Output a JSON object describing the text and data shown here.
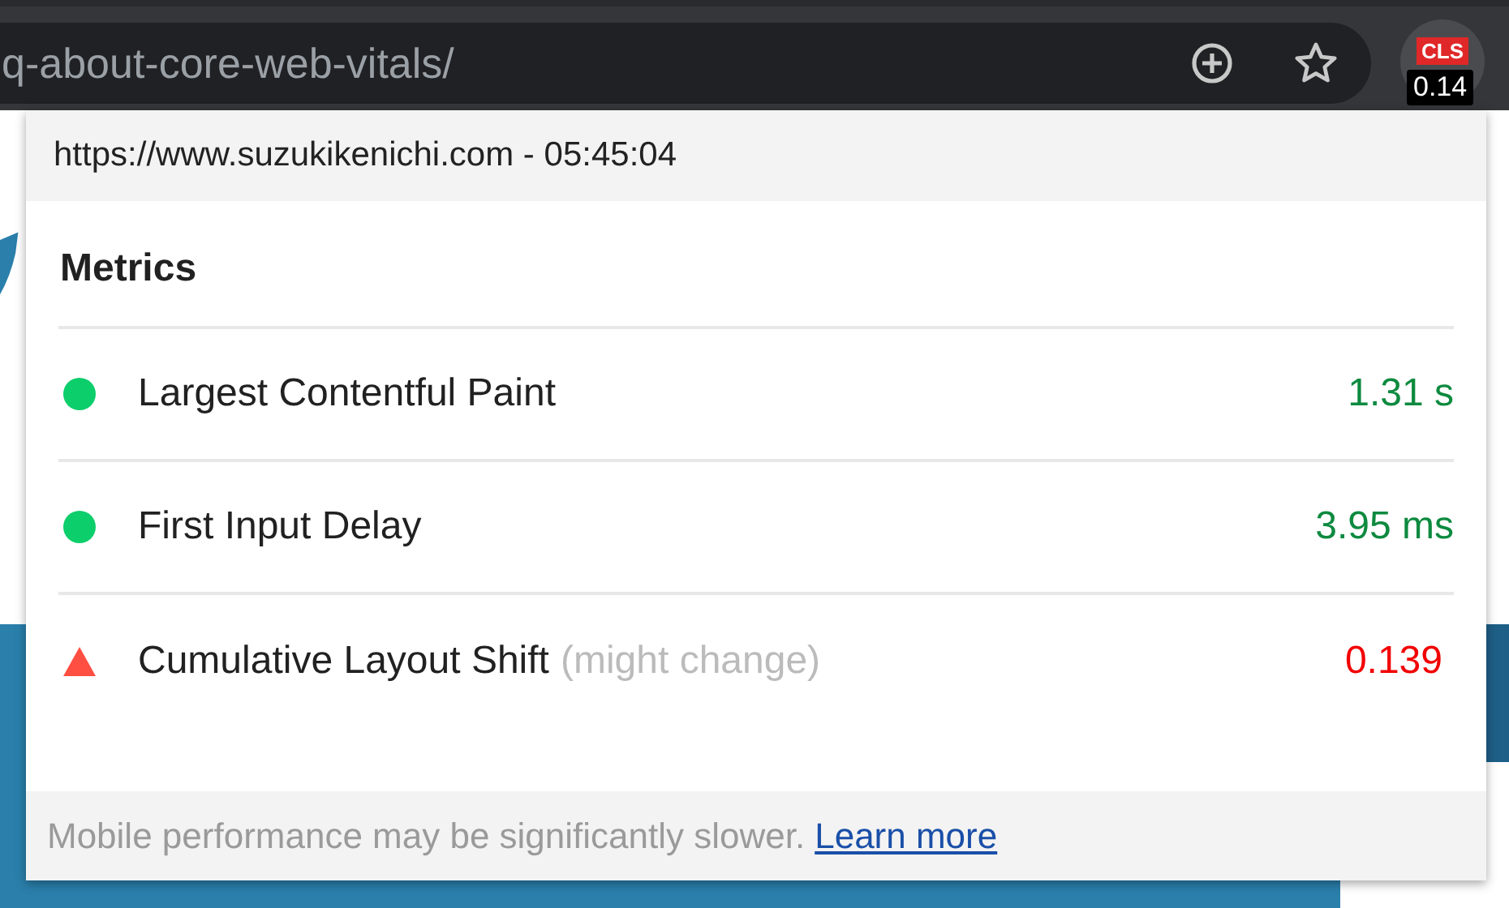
{
  "address_bar": {
    "url_text": "q-about-core-web-vitals/"
  },
  "extension_badge": {
    "label": "CLS",
    "value": "0.14"
  },
  "popup": {
    "header": "https://www.suzukikenichi.com - 05:45:04",
    "title": "Metrics",
    "metrics": [
      {
        "name": "Largest Contentful Paint",
        "value": "1.31 s",
        "kind": "good"
      },
      {
        "name": "First Input Delay",
        "value": "3.95 ms",
        "kind": "good"
      },
      {
        "name": "Cumulative Layout Shift",
        "note": "(might change)",
        "value": "0.139",
        "kind": "poor"
      }
    ],
    "footer": {
      "text": "Mobile performance may be significantly slower.",
      "link": "Learn more"
    }
  }
}
